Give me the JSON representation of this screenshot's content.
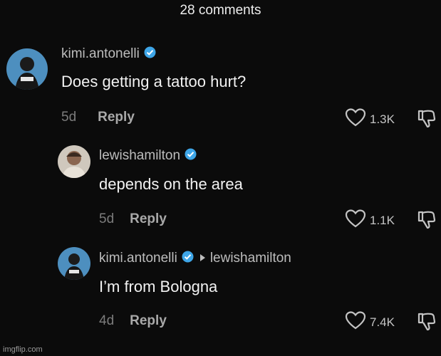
{
  "header": {
    "title": "28 comments"
  },
  "comments": [
    {
      "username": "kimi.antonelli",
      "verified": true,
      "text": "Does getting a tattoo hurt?",
      "age": "5d",
      "reply_label": "Reply",
      "likes": "1.3K"
    },
    {
      "username": "lewishamilton",
      "verified": true,
      "text": "depends on the area",
      "age": "5d",
      "reply_label": "Reply",
      "likes": "1.1K"
    },
    {
      "username": "kimi.antonelli",
      "verified": true,
      "reply_to": "lewishamilton",
      "text": "I’m from Bologna",
      "age": "4d",
      "reply_label": "Reply",
      "likes": "7.4K"
    }
  ],
  "colors": {
    "background": "#0b0b0b",
    "verified": "#3ea6e8"
  },
  "icons": {
    "like": "heart-icon",
    "dislike": "thumbs-down-icon",
    "verified": "verified-check-icon",
    "reply_to": "caret-right-icon"
  },
  "watermark": "imgflip.com"
}
